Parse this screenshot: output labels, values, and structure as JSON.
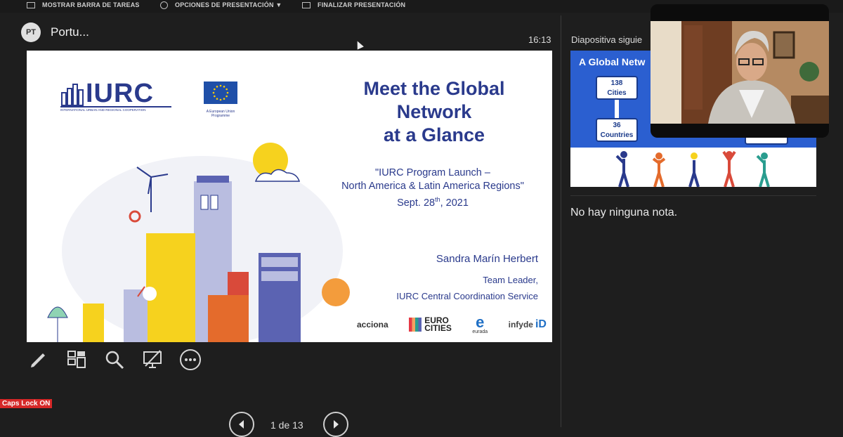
{
  "topbar": {
    "show_taskbar": "MOSTRAR BARRA DE TAREAS",
    "presentation_options": "OPCIONES DE PRESENTACIÓN ▼",
    "end_presentation": "FINALIZAR PRESENTACIÓN"
  },
  "presenter": {
    "initials": "PT",
    "name": "Portu..."
  },
  "clock": "16:13",
  "slide": {
    "logo_main": "IURC",
    "logo_main_caption": "INTERNATIONAL URBAN AND REGIONAL COOPERATION",
    "eu_caption_1": "A European Union",
    "eu_caption_2": "Programme",
    "title_1": "Meet the Global",
    "title_2": "Network",
    "title_3": "at a Glance",
    "sub_1": "\"IURC Program Launch –",
    "sub_2": "North America & Latin America Regions\"",
    "sub_3a": "Sept. 28",
    "sub_3sup": "th",
    "sub_3b": ", 2021",
    "speaker_name": "Sandra Marín Herbert",
    "speaker_role": "Team Leader,",
    "speaker_org": "IURC Central Coordination Service",
    "partners": {
      "acciona": "acciona",
      "eurocities_1": "EURO",
      "eurocities_2": "CITIES",
      "eurada": "eurada",
      "infyde": "infyde"
    }
  },
  "next_slide": {
    "label": "Diapositiva siguie",
    "title": "A Global Netw",
    "cities_num": "138",
    "cities_label": "Cities",
    "countries_num": "36",
    "countries_label": "Countries"
  },
  "notes": "No hay ninguna nota.",
  "caps_lock": "Caps Lock ON",
  "pager": "1 de 13",
  "colors": {
    "brand_blue": "#2a3a8c",
    "eu_blue": "#1f4fa8",
    "eu_star": "#ffcc00",
    "caps_red": "#d62828"
  }
}
